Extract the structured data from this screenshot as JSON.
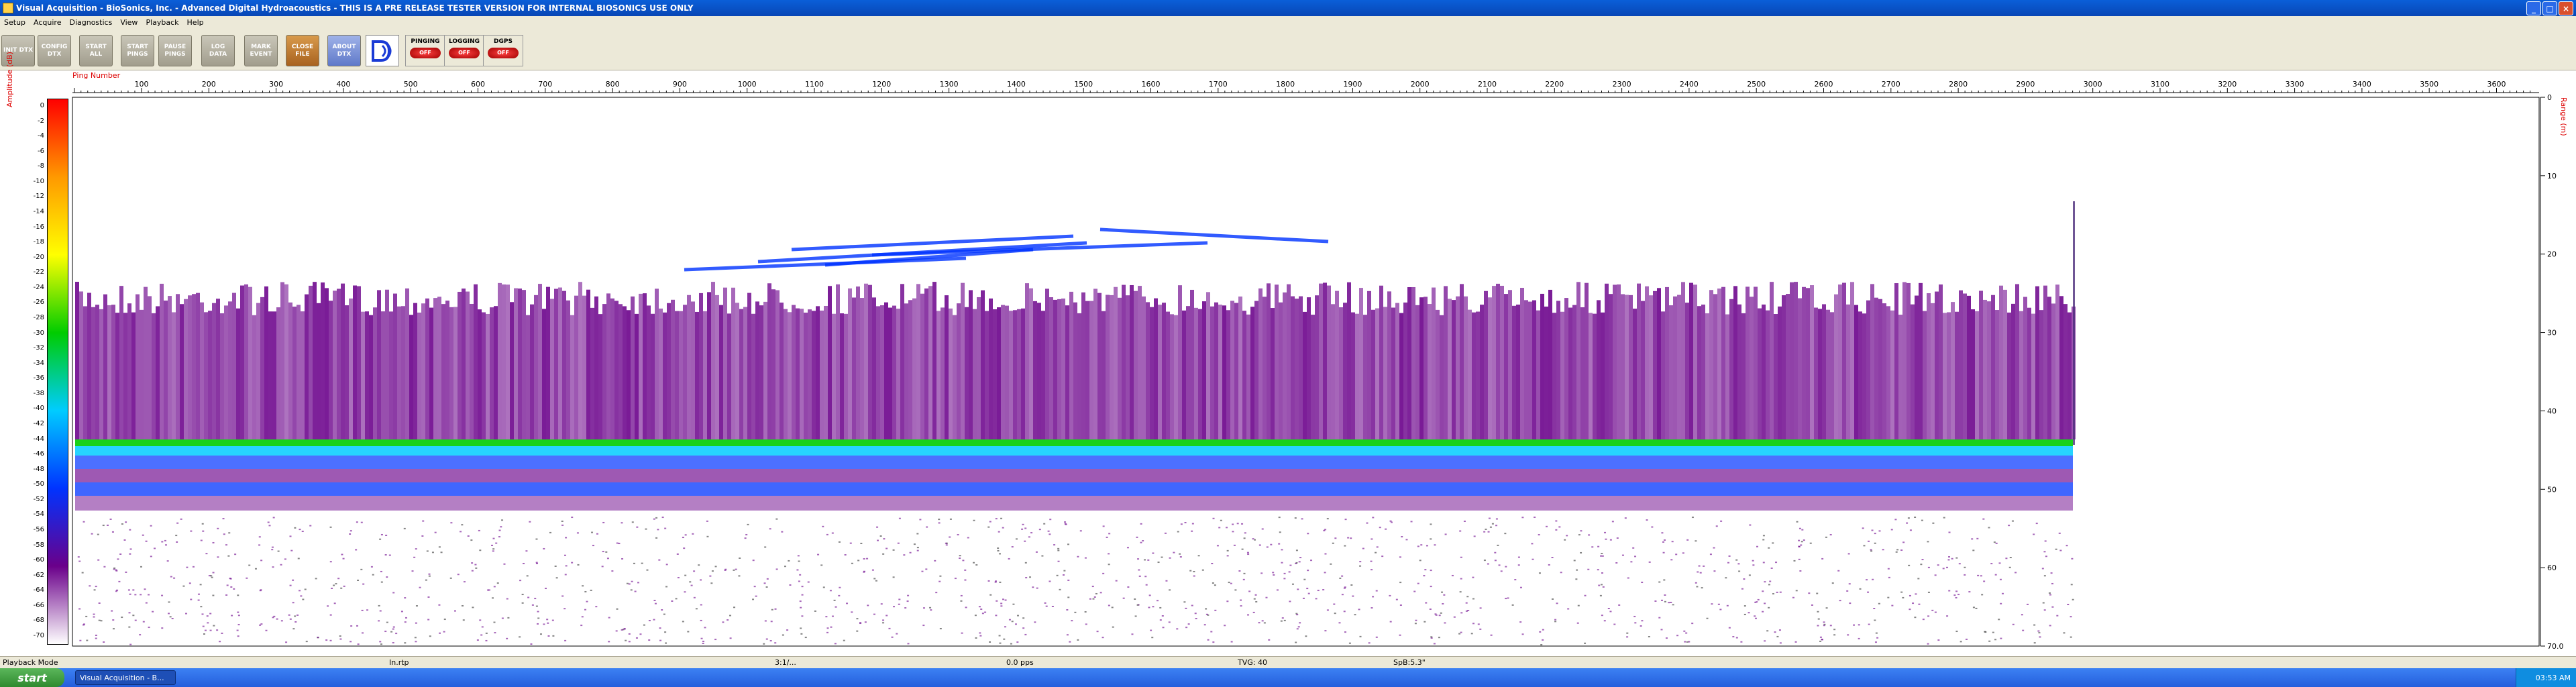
{
  "window": {
    "title": "Visual Acquisition  -  BioSonics, Inc.  -  Advanced Digital Hydroacoustics  -  THIS IS A PRE RELEASE TESTER VERSION FOR INTERNAL BIOSONICS USE ONLY",
    "minimize": "_",
    "maximize": "□",
    "close": "×"
  },
  "menu": [
    "Setup",
    "Acquire",
    "Diagnostics",
    "View",
    "Playback",
    "Help"
  ],
  "toolbar": {
    "buttons": [
      {
        "label": "INIT DTX"
      },
      {
        "label": "CONFIG DTX"
      },
      {
        "label": "START ALL"
      },
      {
        "label": "START PINGS"
      },
      {
        "label": "PAUSE PINGS"
      },
      {
        "label": "LOG DATA"
      },
      {
        "label": "MARK EVENT"
      },
      {
        "label": "CLOSE FILE"
      },
      {
        "label": "ABOUT DTX"
      }
    ],
    "indicators": [
      {
        "label": "PINGING",
        "state": "OFF"
      },
      {
        "label": "LOGGING",
        "state": "OFF"
      },
      {
        "label": "DGPS",
        "state": "OFF"
      }
    ]
  },
  "echogram": {
    "x_title": "Ping Number",
    "left_axis_title": "Amplitude (dB)",
    "right_axis_title": "Range (m)",
    "ping_ticks": [
      100,
      200,
      300,
      400,
      500,
      600,
      700,
      800,
      900,
      1000,
      1100,
      1200,
      1300,
      1400,
      1500,
      1600,
      1700,
      1800,
      1900,
      2000,
      2100,
      2200,
      2300,
      2400,
      2500,
      2600,
      2700,
      2800,
      2900,
      3000,
      3100,
      3200,
      3300,
      3400,
      3500,
      3600
    ],
    "range_ticks": [
      "0",
      "10",
      "20",
      "30",
      "40",
      "50",
      "60",
      "70.0"
    ],
    "amplitude_ticks": [
      "0",
      "-2",
      "-4",
      "-6",
      "-8",
      "-10",
      "-12",
      "-14",
      "-16",
      "-18",
      "-20",
      "-22",
      "-24",
      "-26",
      "-28",
      "-30",
      "-32",
      "-34",
      "-36",
      "-38",
      "-40",
      "-42",
      "-44",
      "-46",
      "-48",
      "-50",
      "-52",
      "-54",
      "-56",
      "-58",
      "-60",
      "-62",
      "-64",
      "-66",
      "-68",
      "-70"
    ],
    "colors": {
      "scale_top": "#ff0000",
      "scale_orange": "#ff9900",
      "scale_yellow": "#ffff00",
      "scale_green": "#00cc00",
      "scale_cyan": "#00ccff",
      "scale_blue": "#0033ff",
      "scale_purple": "#6a008a",
      "scale_bottom": "#ffffff"
    }
  },
  "status": {
    "mode": "Playback Mode",
    "file": "In.rtp",
    "rate": "3:1/...",
    "pps": "0.0 pps",
    "tvg": "TVG: 40",
    "spb": "SpB:5.3\""
  },
  "taskbar": {
    "start": "start",
    "item": "Visual Acquisition - B...",
    "clock": "03:53 AM"
  }
}
